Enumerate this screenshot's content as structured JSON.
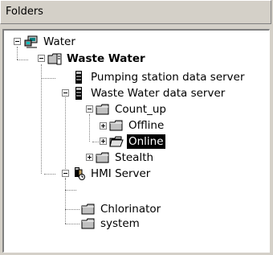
{
  "header": {
    "title": "Folders"
  },
  "tree": {
    "nodes": [
      {
        "label": "Water"
      },
      {
        "label": "Waste Water"
      },
      {
        "label": "Pumping station data server"
      },
      {
        "label": "Waste Water data server"
      },
      {
        "label": "Count_up"
      },
      {
        "label": "Offline"
      },
      {
        "label": "Online"
      },
      {
        "label": "Stealth"
      },
      {
        "label": "HMI Server"
      },
      {
        "label": "Chlorinator"
      },
      {
        "label": "system"
      }
    ]
  },
  "colors": {
    "panel_bg": "#d4d0c8",
    "tree_bg": "#ffffff",
    "selection_bg": "#000000",
    "selection_text": "#ffffff",
    "folder_fill": "#c0c0c0"
  }
}
